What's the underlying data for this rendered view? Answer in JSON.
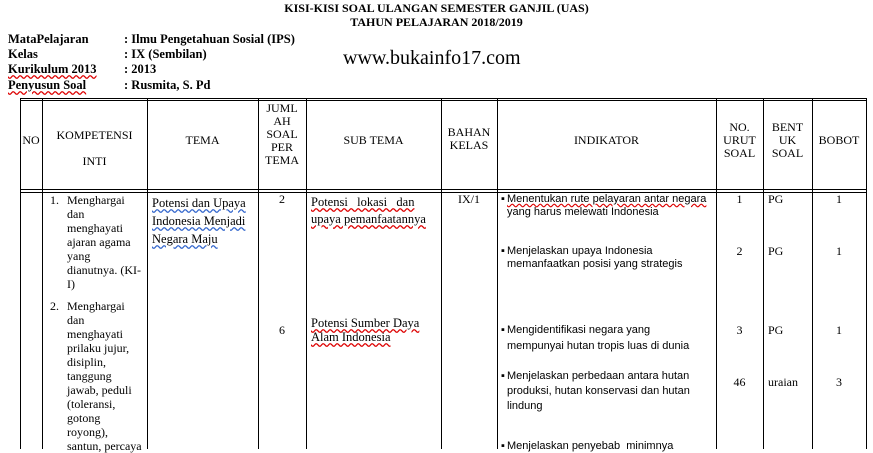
{
  "title": {
    "line1": "KISI-KISI SOAL ULANGAN SEMESTER GANJIL (UAS)",
    "line2": "TAHUN PELAJARAN 2018/2019"
  },
  "meta": [
    {
      "label": "MataPelajaran",
      "value": ": Ilmu Pengetahuan Sosial (IPS)"
    },
    {
      "label": "Kelas",
      "value": ": IX (Sembilan)"
    },
    {
      "label": "Kurikulum 2013",
      "value": ": 2013"
    },
    {
      "label": "Penyusun Soal",
      "value": ": Rusmita, S. Pd"
    }
  ],
  "watermark": "www.bukainfo17.com",
  "table": {
    "headers": {
      "no": "NO",
      "kompetensi": [
        "KOMPETENSI",
        "INTI"
      ],
      "tema": "TEMA",
      "jumlah": [
        "JUML",
        "AH",
        "SOAL",
        "PER",
        "TEMA"
      ],
      "subtema": "SUB TEMA",
      "bahan": [
        "BAHAN",
        "KELAS"
      ],
      "indikator": "INDIKATOR",
      "urut": [
        "NO.",
        "URUT",
        "SOAL"
      ],
      "bentuk": [
        "BENT",
        "UK",
        "SOAL"
      ],
      "bobot": "BOBOT"
    },
    "kompetensi_items": [
      {
        "num": "1.",
        "lines": [
          "Menghargai",
          "dan",
          "menghayati",
          "ajaran agama",
          "yang",
          "dianutnya. (KI-",
          "I)"
        ]
      },
      {
        "num": "2.",
        "lines": [
          "Menghargai",
          "dan",
          "menghayati",
          "prilaku jujur,",
          "disiplin,",
          "tanggung",
          "jawab, peduli",
          "(toleransi,",
          "gotong",
          "royong),",
          "santun, percaya"
        ]
      }
    ],
    "tema": [
      "Potensi dan Upaya",
      "Indonesia Menjadi",
      "Negara Maju"
    ],
    "jumlah_values": [
      "2",
      "6"
    ],
    "subtema": [
      [
        "Potensi   lokasi   dan",
        "upaya pemanfaatannya"
      ],
      [
        "Potensi Sumber Daya",
        "Alam Indonesia"
      ]
    ],
    "bahan_kelas": "IX/1",
    "indikator": [
      [
        "Menentukan rute pelayaran antar negara",
        "yang harus melewati Indonesia"
      ],
      [
        "Menjelaskan upaya Indonesia",
        "memanfaatkan posisi yang strategis"
      ],
      [
        "Mengidentifikasi negara yang",
        "mempunyai hutan tropis luas di dunia"
      ],
      [
        "Menjelaskan perbedaan antara hutan",
        "produksi, hutan konservasi dan hutan",
        "lindung"
      ],
      [
        "Menjelaskan penyebab  minimnya"
      ]
    ],
    "rows": [
      {
        "urut": "1",
        "bentuk": "PG",
        "bobot": "1"
      },
      {
        "urut": "2",
        "bentuk": "PG",
        "bobot": "1"
      },
      {
        "urut": "3",
        "bentuk": "PG",
        "bobot": "1"
      },
      {
        "urut": "46",
        "bentuk": "uraian",
        "bobot": "3"
      }
    ]
  }
}
